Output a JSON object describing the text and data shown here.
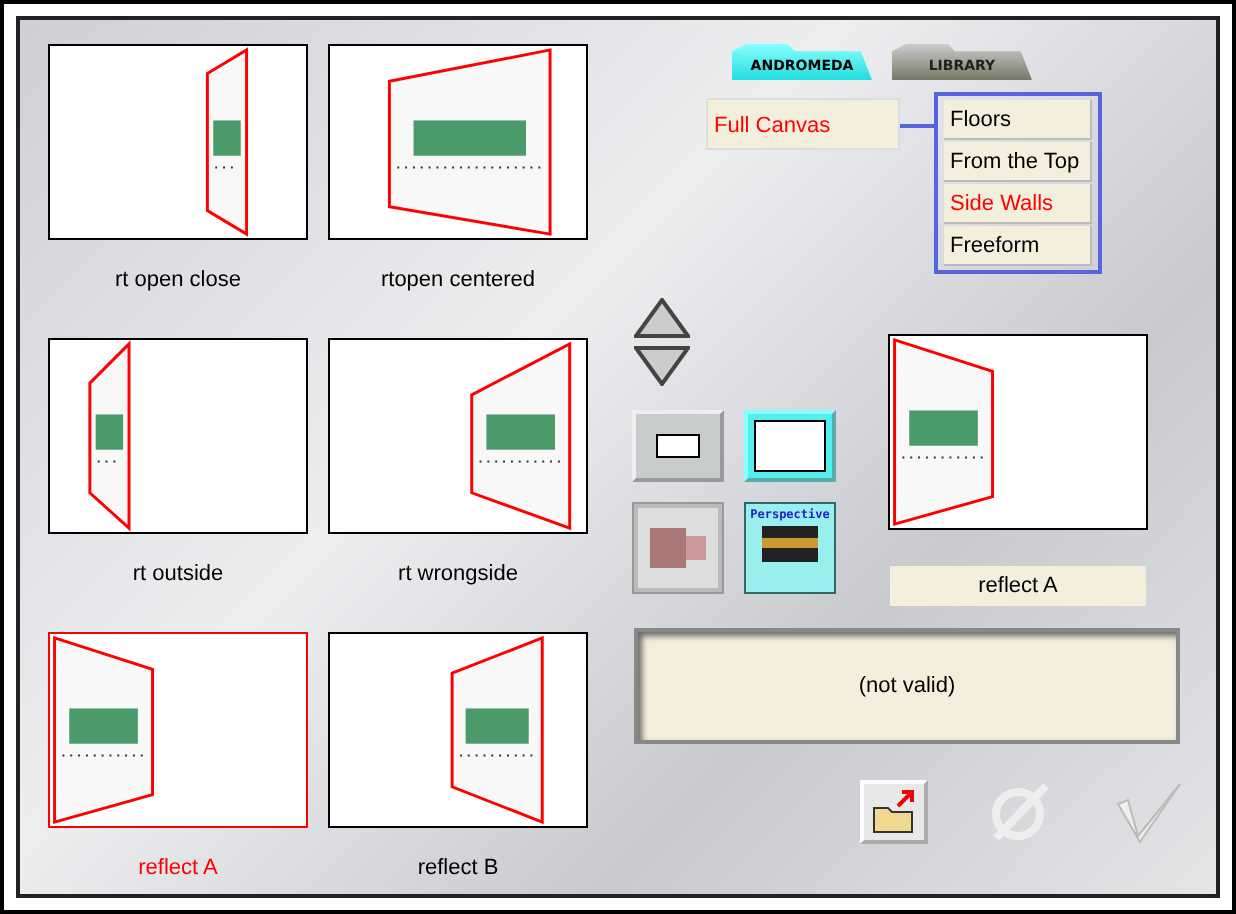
{
  "thumbnails": [
    {
      "label": "rt open close",
      "selected": false
    },
    {
      "label": "rtopen centered",
      "selected": false
    },
    {
      "label": "rt outside",
      "selected": false
    },
    {
      "label": "rt wrongside",
      "selected": false
    },
    {
      "label": "reflect A",
      "selected": true
    },
    {
      "label": "reflect B",
      "selected": false
    }
  ],
  "tabs": [
    {
      "label": "ANDROMEDA",
      "selected": true
    },
    {
      "label": "LIBRARY",
      "selected": false
    }
  ],
  "canvas_field": {
    "value": "Full Canvas"
  },
  "view_list": [
    {
      "label": "Floors",
      "selected": false
    },
    {
      "label": "From the Top",
      "selected": false
    },
    {
      "label": "Side Walls",
      "selected": true
    },
    {
      "label": "Freeform",
      "selected": false
    }
  ],
  "size_buttons": [
    {
      "kind": "small",
      "selected": false
    },
    {
      "kind": "large",
      "selected": true
    }
  ],
  "style_buttons": [
    {
      "kind": "texture",
      "selected": false
    },
    {
      "kind": "perspective",
      "label": "Perspective",
      "selected": true
    }
  ],
  "preview": {
    "label": "reflect A"
  },
  "status": "(not valid)"
}
